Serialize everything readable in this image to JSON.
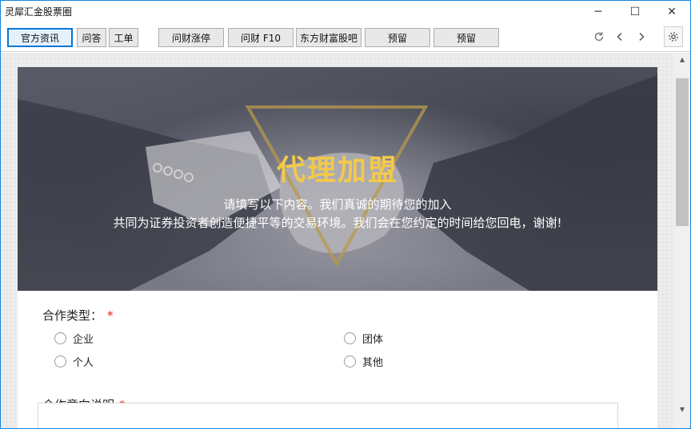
{
  "window": {
    "title": "灵犀汇金股票圈",
    "controls": {
      "minimize": "─",
      "maximize": "☐",
      "close": "✕"
    }
  },
  "toolbar": {
    "tabs": [
      {
        "label": "官方资讯"
      },
      {
        "label": "问答"
      },
      {
        "label": "工单"
      },
      {
        "label": "问财涨停"
      },
      {
        "label": "问财 F10"
      },
      {
        "label": "东方财富股吧"
      },
      {
        "label": "预留"
      },
      {
        "label": "预留"
      }
    ],
    "active_tab": "官方资讯",
    "icons": {
      "refresh": "refresh-icon",
      "back": "chevron-left-icon",
      "forward": "chevron-right-icon",
      "settings": "gear-icon"
    }
  },
  "hero": {
    "title": "代理加盟",
    "line1": "请填写以下内容。我们真诚的期待您的加入",
    "line2": "共同为证券投资者创造便捷平等的交易环境。我们会在您约定的时间给您回电，谢谢!",
    "title_color": "#f3c94a"
  },
  "form": {
    "cooperation_type": {
      "label": "合作类型：",
      "required_mark": "*",
      "options": [
        "企业",
        "团体",
        "个人",
        "其他"
      ]
    },
    "intent": {
      "label": "合作意向说明",
      "required_mark": "*",
      "value": ""
    }
  },
  "colors": {
    "accent": "#0078d7",
    "required": "#d9230f",
    "window_border": "#1883d7"
  }
}
